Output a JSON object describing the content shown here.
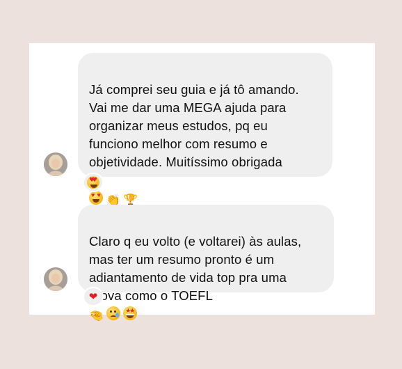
{
  "messages": [
    {
      "text": "Já comprei seu guia e já tô amando.\nVai me dar uma MEGA ajuda para\norganizar meus estudos, pq eu\nfunciono melhor com resumo e\nobjetividade. Muitíssimo obrigada",
      "emojis": [
        "smiling-face-with-heart-eyes",
        "clapping-hands",
        "trophy"
      ],
      "reaction": "smiling-face-with-heart-eyes"
    },
    {
      "text": "Claro q eu volto (e voltarei) às aulas,\nmas ter um resumo pronto é um\nadiantamento de vida top pra uma\nprova como o TOEFL",
      "emojis": [
        "pinching-hand",
        "crying-face",
        "star-struck"
      ],
      "reaction": "red-heart"
    }
  ],
  "glyphs": {
    "clap": "👏",
    "trophy": "🏆",
    "pinch": "🤏",
    "heart": "❤"
  },
  "colors": {
    "page_background": "#ece1dc",
    "card_background": "#ffffff",
    "bubble_background": "#efefef",
    "text": "#111111",
    "heart": "#e31b23"
  }
}
